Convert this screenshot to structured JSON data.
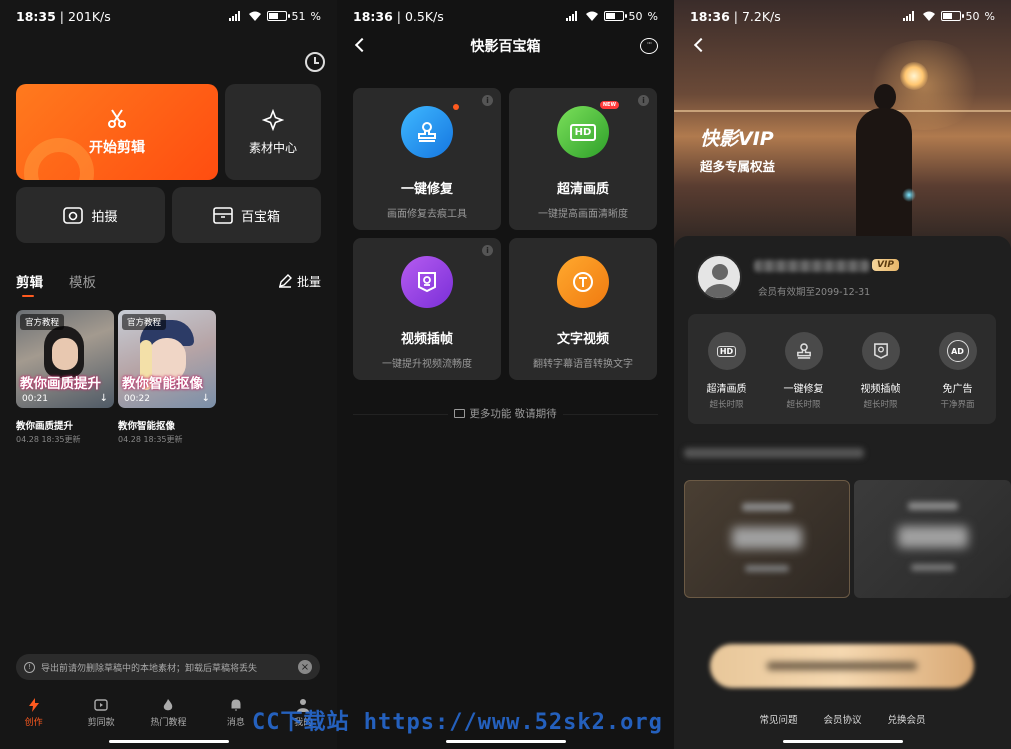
{
  "screen1": {
    "status": {
      "time": "18:35",
      "speed": "201K/s",
      "battery": "51"
    },
    "start_edit": "开始剪辑",
    "materials": "素材中心",
    "shoot": "拍摄",
    "toolbox": "百宝箱",
    "tabs": {
      "edit": "剪辑",
      "template": "模板",
      "batch": "批量"
    },
    "videos": [
      {
        "tag": "官方教程",
        "overlay": "教你画质提升",
        "duration": "00:21",
        "title": "教你画质提升",
        "updated": "04.28 18:35更新"
      },
      {
        "tag": "官方教程",
        "overlay": "教你智能抠像",
        "duration": "00:22",
        "title": "教你智能抠像",
        "updated": "04.28 18:35更新"
      }
    ],
    "notice": "导出前请勿删除草稿中的本地素材；卸载后草稿将丢失",
    "nav": [
      "创作",
      "剪同款",
      "热门教程",
      "消息",
      "我的"
    ]
  },
  "screen2": {
    "status": {
      "time": "18:36",
      "speed": "0.5K/s",
      "battery": "50"
    },
    "title": "快影百宝箱",
    "tools": [
      {
        "title": "一键修复",
        "sub": "画面修复去痕工具",
        "color": "#1e8fe6"
      },
      {
        "title": "超清画质",
        "sub": "一键提高画面清晰度",
        "color": "#3fbf3a"
      },
      {
        "title": "视频插帧",
        "sub": "一键提升视频流畅度",
        "color": "#8a3fe0"
      },
      {
        "title": "文字视频",
        "sub": "翻转字幕语音转换文字",
        "color": "#f08a10"
      }
    ],
    "new_badge": "NEW",
    "hd_icon": "HD",
    "more": "更多功能 敬请期待"
  },
  "screen3": {
    "status": {
      "time": "18:36",
      "speed": "7.2K/s",
      "battery": "50"
    },
    "hero_title": "快影VIP",
    "hero_sub": "超多专属权益",
    "vip_badge": "VIP",
    "expire": "会员有效期至2099-12-31",
    "perks": [
      {
        "label": "超清画质",
        "sub": "超长时限",
        "icon": "HD"
      },
      {
        "label": "一键修复",
        "sub": "超长时限",
        "icon": "repair"
      },
      {
        "label": "视频插帧",
        "sub": "超长时限",
        "icon": "frame"
      },
      {
        "label": "免广告",
        "sub": "干净界面",
        "icon": "AD"
      }
    ],
    "links": [
      "常见问题",
      "会员协议",
      "兑换会员"
    ]
  },
  "watermark": "CC下载站 https://www.52sk2.org"
}
